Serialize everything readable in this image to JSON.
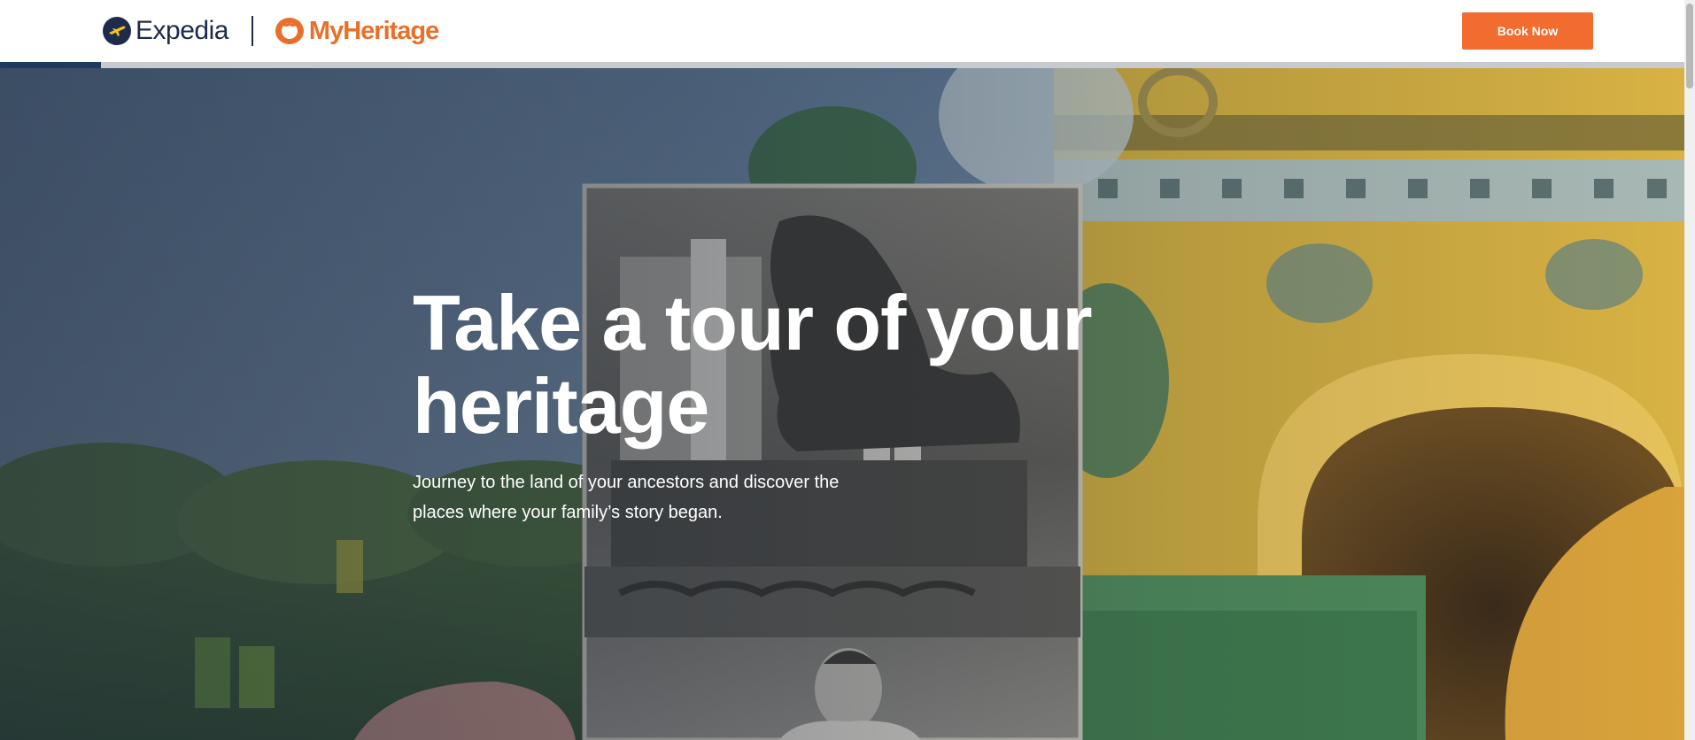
{
  "header": {
    "expedia_logo_text": "Expedia",
    "myheritage_logo_text": "MyHeritage",
    "book_button_label": "Book Now"
  },
  "hero": {
    "title": "Take a tour of your heritage",
    "subtitle": "Journey to the land of your ancestors and discover the places where your family’s story began."
  },
  "colors": {
    "expedia_navy": "#1f2b4d",
    "expedia_yellow": "#f5c518",
    "myheritage_orange": "#e8702a",
    "book_button_bg": "#f26b2f",
    "progress_fill": "#1e3a5f"
  },
  "icons": {
    "expedia_mark": "plane-in-circle-icon",
    "myheritage_mark": "family-tree-icon"
  },
  "page_progress": 0.06
}
